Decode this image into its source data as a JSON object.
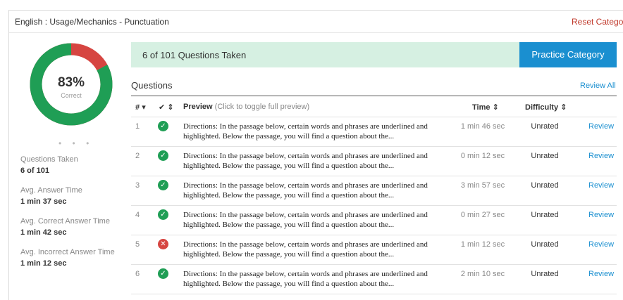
{
  "header": {
    "title": "English : Usage/Mechanics - Punctuation",
    "reset_label": "Reset Category"
  },
  "summary": {
    "percent": "83%",
    "percent_label": "Correct",
    "correct_fraction": 0.83,
    "colors": {
      "correct": "#1f9e55",
      "incorrect": "#d64541"
    },
    "dots": "• • •",
    "stats": [
      {
        "label": "Questions Taken",
        "value": "6 of 101"
      },
      {
        "label": "Avg. Answer Time",
        "value": "1 min 37 sec"
      },
      {
        "label": "Avg. Correct Answer Time",
        "value": "1 min 42 sec"
      },
      {
        "label": "Avg. Incorrect Answer Time",
        "value": "1 min 12 sec"
      }
    ]
  },
  "banner": {
    "text": "6 of 101 Questions Taken",
    "practice_label": "Practice Category"
  },
  "questions": {
    "heading": "Questions",
    "review_all_label": "Review All",
    "columns": {
      "num": "#",
      "num_sort": "▾",
      "correct": "✔",
      "correct_sort": "⇕",
      "preview": "Preview",
      "preview_hint": "(Click to toggle full preview)",
      "time": "Time",
      "time_sort": "⇕",
      "difficulty": "Difficulty",
      "difficulty_sort": "⇕"
    },
    "rows": [
      {
        "num": "1",
        "correct": true,
        "icon": "check-icon",
        "preview": "Directions: In the passage below, certain words and phrases are underlined and highlighted. Below the passage, you will find a question about the...",
        "time": "1 min 46 sec",
        "difficulty": "Unrated",
        "review": "Review"
      },
      {
        "num": "2",
        "correct": true,
        "icon": "check-icon",
        "preview": "Directions: In the passage below, certain words and phrases are underlined and highlighted. Below the passage, you will find a question about the...",
        "time": "0 min 12 sec",
        "difficulty": "Unrated",
        "review": "Review"
      },
      {
        "num": "3",
        "correct": true,
        "icon": "check-icon",
        "preview": "Directions: In the passage below, certain words and phrases are underlined and highlighted. Below the passage, you will find a question about the...",
        "time": "3 min 57 sec",
        "difficulty": "Unrated",
        "review": "Review"
      },
      {
        "num": "4",
        "correct": true,
        "icon": "check-icon",
        "preview": "Directions: In the passage below, certain words and phrases are underlined and highlighted. Below the passage, you will find a question about the...",
        "time": "0 min 27 sec",
        "difficulty": "Unrated",
        "review": "Review"
      },
      {
        "num": "5",
        "correct": false,
        "icon": "x-icon",
        "preview": "Directions: In the passage below, certain words and phrases are underlined and highlighted. Below the passage, you will find a question about the...",
        "time": "1 min 12 sec",
        "difficulty": "Unrated",
        "review": "Review"
      },
      {
        "num": "6",
        "correct": true,
        "icon": "check-icon",
        "preview": "Directions: In the passage below, certain words and phrases are underlined and highlighted. Below the passage, you will find a question about the...",
        "time": "2 min 10 sec",
        "difficulty": "Unrated",
        "review": "Review"
      }
    ]
  }
}
